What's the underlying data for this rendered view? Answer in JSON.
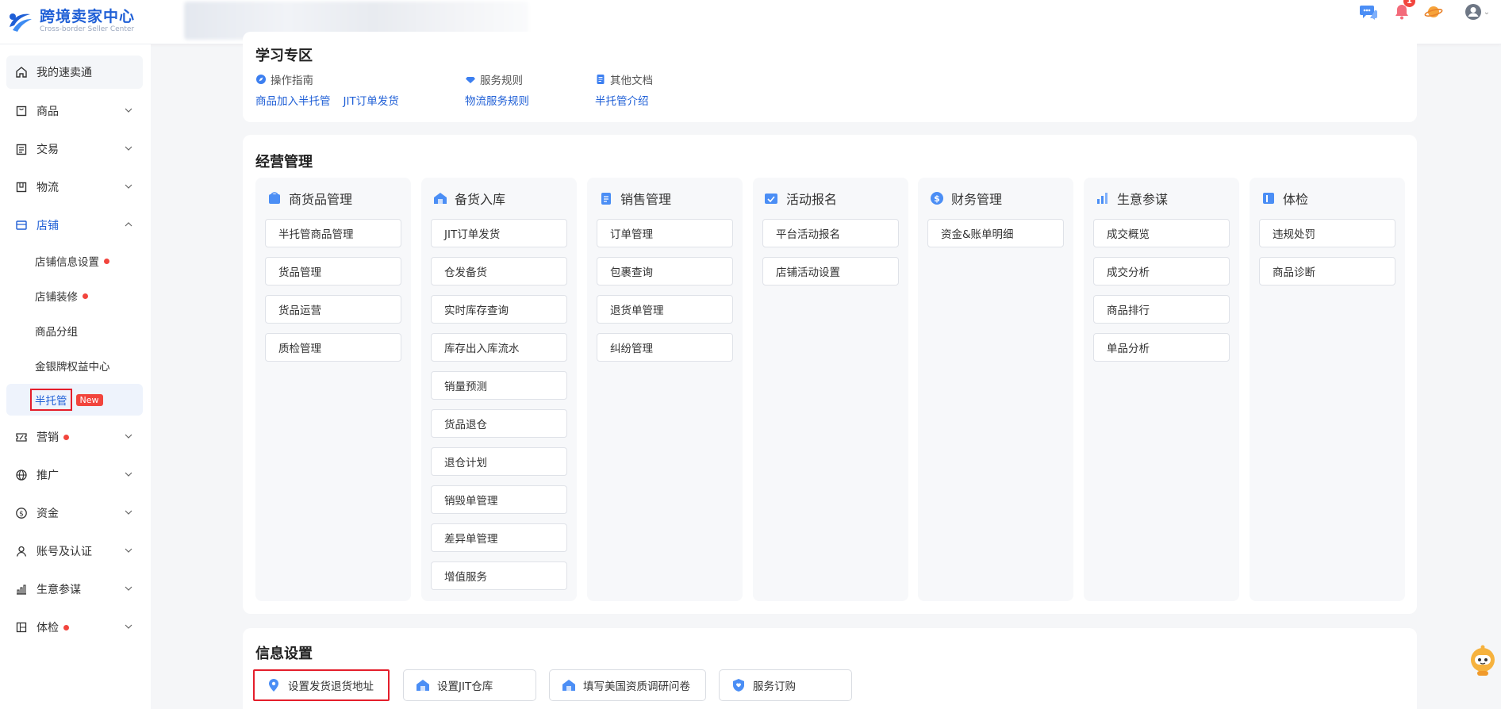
{
  "header": {
    "title": "跨境卖家中心",
    "subtitle": "Cross-border Seller Center",
    "notification_count": "1"
  },
  "sidebar": {
    "items": [
      {
        "label": "我的速卖通",
        "icon": "home-icon"
      },
      {
        "label": "商品",
        "icon": "bag-icon"
      },
      {
        "label": "交易",
        "icon": "clipboard-icon"
      },
      {
        "label": "物流",
        "icon": "truck-box-icon"
      },
      {
        "label": "店铺",
        "icon": "store-icon"
      },
      {
        "label": "营销",
        "icon": "ticket-icon"
      },
      {
        "label": "推广",
        "icon": "globe-icon"
      },
      {
        "label": "资金",
        "icon": "dollar-icon"
      },
      {
        "label": "账号及认证",
        "icon": "user-icon"
      },
      {
        "label": "生意参谋",
        "icon": "bar-chart-icon"
      },
      {
        "label": "体检",
        "icon": "health-check-icon"
      }
    ],
    "store_sub": [
      {
        "label": "店铺信息设置"
      },
      {
        "label": "店铺装修"
      },
      {
        "label": "商品分组"
      },
      {
        "label": "金银牌权益中心"
      },
      {
        "label": "半托管",
        "badge": "New"
      }
    ]
  },
  "learning": {
    "title": "学习专区",
    "columns": [
      {
        "heading": "操作指南",
        "links": [
          "商品加入半托管",
          "JIT订单发货"
        ]
      },
      {
        "heading": "服务规则",
        "links": [
          "物流服务规则"
        ]
      },
      {
        "heading": "其他文档",
        "links": [
          "半托管介绍"
        ]
      }
    ]
  },
  "management": {
    "title": "经营管理",
    "columns": [
      {
        "heading": "商货品管理",
        "items": [
          "半托管商品管理",
          "货品管理",
          "货品运营",
          "质检管理"
        ]
      },
      {
        "heading": "备货入库",
        "items": [
          "JIT订单发货",
          "仓发备货",
          "实时库存查询",
          "库存出入库流水",
          "销量预测",
          "货品退仓",
          "退仓计划",
          "销毁单管理",
          "差异单管理",
          "增值服务"
        ]
      },
      {
        "heading": "销售管理",
        "items": [
          "订单管理",
          "包裹查询",
          "退货单管理",
          "纠纷管理"
        ]
      },
      {
        "heading": "活动报名",
        "items": [
          "平台活动报名",
          "店铺活动设置"
        ]
      },
      {
        "heading": "财务管理",
        "items": [
          "资金&账单明细"
        ]
      },
      {
        "heading": "生意参谋",
        "items": [
          "成交概览",
          "成交分析",
          "商品排行",
          "单品分析"
        ]
      },
      {
        "heading": "体检",
        "items": [
          "违规处罚",
          "商品诊断"
        ]
      }
    ]
  },
  "info": {
    "title": "信息设置",
    "buttons": [
      "设置发货退货地址",
      "设置JIT仓库",
      "填写美国资质调研问卷",
      "服务订购"
    ]
  },
  "colors": {
    "accent": "#1f5fd6",
    "highlight": "#e41e2b",
    "badge": "#f2453d"
  }
}
